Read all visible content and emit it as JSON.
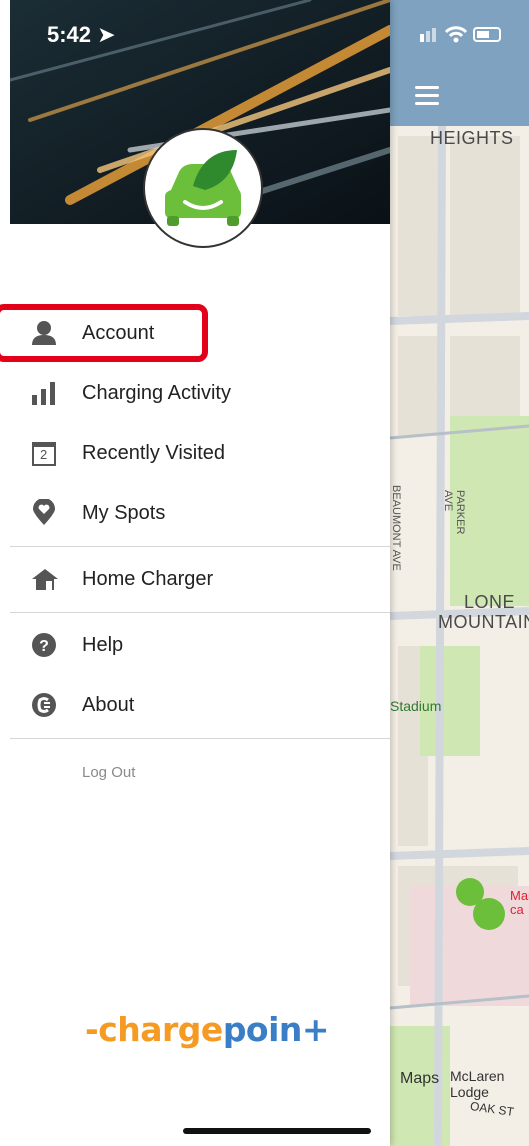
{
  "status_bar": {
    "time": "5:42"
  },
  "map": {
    "labels": {
      "heights": "HEIGHTS",
      "lone": "LONE",
      "mountain": "MOUNTAIN",
      "beaumont": "BEAUMONT AVE",
      "parker": "PARKER AVE",
      "stadium": "Stadium",
      "mar": "Mar",
      "ca": "ca",
      "lodge": "McLaren Lodge",
      "oak": "OAK ST",
      "maps_credit": "Maps"
    }
  },
  "menu": {
    "items": [
      {
        "label": "Account",
        "icon": "user-icon"
      },
      {
        "label": "Charging Activity",
        "icon": "bar-chart-icon"
      },
      {
        "label": "Recently Visited",
        "icon": "calendar-icon"
      },
      {
        "label": "My Spots",
        "icon": "location-heart-icon"
      },
      {
        "label": "Home Charger",
        "icon": "home-charger-icon"
      },
      {
        "label": "Help",
        "icon": "help-icon"
      },
      {
        "label": "About",
        "icon": "about-icon"
      }
    ],
    "logout": "Log Out",
    "calendar_day": "2"
  },
  "brand": {
    "part1": "-charge",
    "part2": "poin+"
  },
  "colors": {
    "highlight": "#e3001b",
    "brand_orange": "#f59a23",
    "brand_blue": "#3a7ec6",
    "logo_green": "#6bbf3a"
  }
}
